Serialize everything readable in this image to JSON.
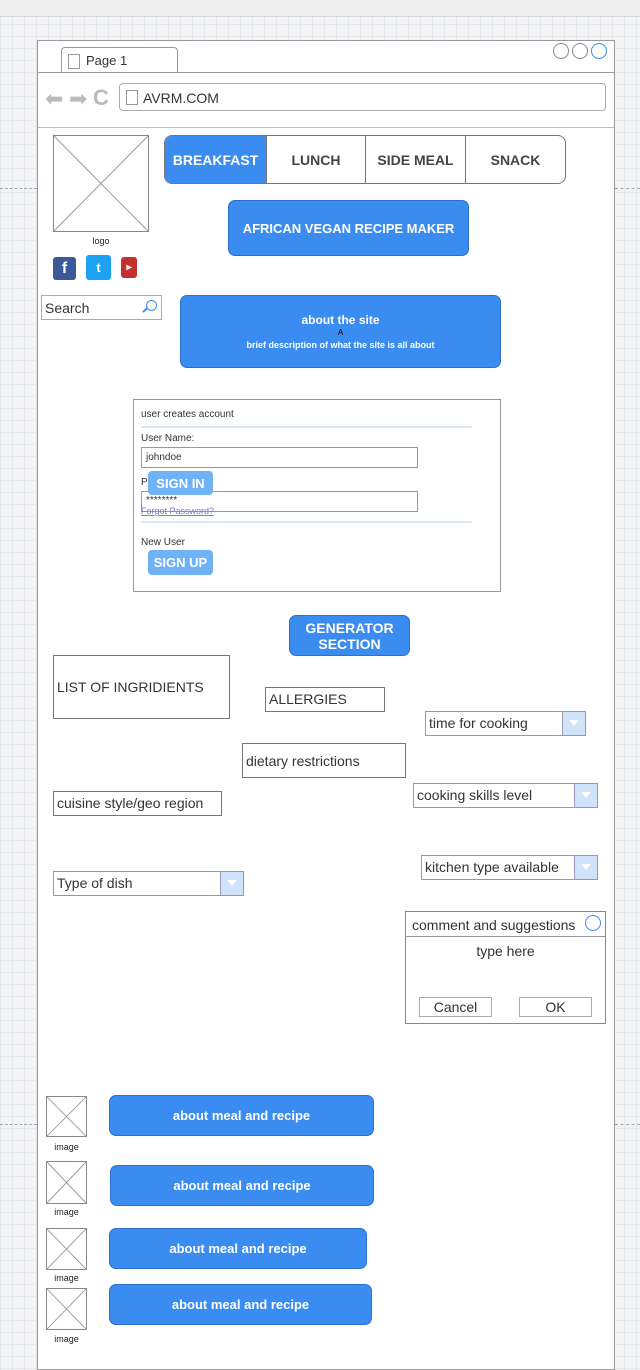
{
  "browser": {
    "tab_label": "Page 1",
    "url": "AVRM.COM"
  },
  "header": {
    "logo_label": "logo",
    "nav": [
      {
        "label": "BREAKFAST",
        "active": true
      },
      {
        "label": "LUNCH",
        "active": false
      },
      {
        "label": "SIDE MEAL",
        "active": false
      },
      {
        "label": "SNACK",
        "active": false
      }
    ],
    "app_title": "AFRICAN VEGAN RECIPE MAKER",
    "social": [
      {
        "icon": "facebook-icon",
        "glyph": "f",
        "color": "#3b5998"
      },
      {
        "icon": "twitter-icon",
        "glyph": "t",
        "color": "#1da1f2"
      },
      {
        "icon": "youtube-icon",
        "glyph": "▸",
        "color": "#c4302b"
      }
    ]
  },
  "search": {
    "placeholder": "Search"
  },
  "about": {
    "title": "about the site",
    "marker": "A",
    "description": "brief description of what the site is all about"
  },
  "account": {
    "heading": "user creates account",
    "username_label": "User Name:",
    "username_value": "johndoe",
    "password_label": "P",
    "password_value": "********",
    "sign_in": "SIGN IN",
    "forgot": "Forgot Password?",
    "new_user": "New User",
    "sign_up": "SIGN UP"
  },
  "generator": {
    "title": "GENERATOR SECTION",
    "ingredients": "LIST OF INGRIDIENTS",
    "allergies": "ALLERGIES",
    "time_for_cooking": "time for cooking",
    "dietary": "dietary restrictions",
    "cuisine": "cuisine style/geo region",
    "skills": "cooking skills level",
    "kitchen": "kitchen type available",
    "dish_type": "Type of dish"
  },
  "comment_dialog": {
    "title": "comment and suggestions",
    "placeholder": "type here",
    "cancel": "Cancel",
    "ok": "OK"
  },
  "meals": [
    {
      "image_label": "image",
      "button": "about meal and recipe"
    },
    {
      "image_label": "image",
      "button": "about meal and recipe"
    },
    {
      "image_label": "image",
      "button": "about meal and recipe"
    },
    {
      "image_label": "image",
      "button": "about meal and recipe"
    }
  ],
  "colors": {
    "accent": "#3b8cf0",
    "light_accent": "#6fb2f5"
  }
}
